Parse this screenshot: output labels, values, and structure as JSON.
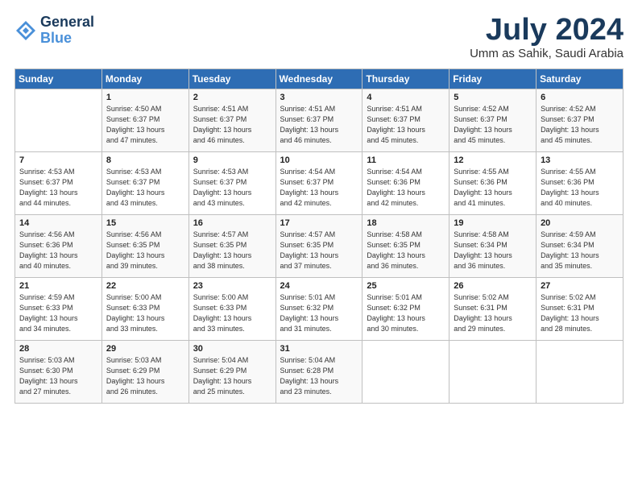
{
  "header": {
    "logo_line1": "General",
    "logo_line2": "Blue",
    "month_title": "July 2024",
    "location": "Umm as Sahik, Saudi Arabia"
  },
  "days_of_week": [
    "Sunday",
    "Monday",
    "Tuesday",
    "Wednesday",
    "Thursday",
    "Friday",
    "Saturday"
  ],
  "weeks": [
    [
      {
        "day": "",
        "sunrise": "",
        "sunset": "",
        "daylight": ""
      },
      {
        "day": "1",
        "sunrise": "Sunrise: 4:50 AM",
        "sunset": "Sunset: 6:37 PM",
        "daylight": "Daylight: 13 hours and 47 minutes."
      },
      {
        "day": "2",
        "sunrise": "Sunrise: 4:51 AM",
        "sunset": "Sunset: 6:37 PM",
        "daylight": "Daylight: 13 hours and 46 minutes."
      },
      {
        "day": "3",
        "sunrise": "Sunrise: 4:51 AM",
        "sunset": "Sunset: 6:37 PM",
        "daylight": "Daylight: 13 hours and 46 minutes."
      },
      {
        "day": "4",
        "sunrise": "Sunrise: 4:51 AM",
        "sunset": "Sunset: 6:37 PM",
        "daylight": "Daylight: 13 hours and 45 minutes."
      },
      {
        "day": "5",
        "sunrise": "Sunrise: 4:52 AM",
        "sunset": "Sunset: 6:37 PM",
        "daylight": "Daylight: 13 hours and 45 minutes."
      },
      {
        "day": "6",
        "sunrise": "Sunrise: 4:52 AM",
        "sunset": "Sunset: 6:37 PM",
        "daylight": "Daylight: 13 hours and 45 minutes."
      }
    ],
    [
      {
        "day": "7",
        "sunrise": "Sunrise: 4:53 AM",
        "sunset": "Sunset: 6:37 PM",
        "daylight": "Daylight: 13 hours and 44 minutes."
      },
      {
        "day": "8",
        "sunrise": "Sunrise: 4:53 AM",
        "sunset": "Sunset: 6:37 PM",
        "daylight": "Daylight: 13 hours and 43 minutes."
      },
      {
        "day": "9",
        "sunrise": "Sunrise: 4:53 AM",
        "sunset": "Sunset: 6:37 PM",
        "daylight": "Daylight: 13 hours and 43 minutes."
      },
      {
        "day": "10",
        "sunrise": "Sunrise: 4:54 AM",
        "sunset": "Sunset: 6:37 PM",
        "daylight": "Daylight: 13 hours and 42 minutes."
      },
      {
        "day": "11",
        "sunrise": "Sunrise: 4:54 AM",
        "sunset": "Sunset: 6:36 PM",
        "daylight": "Daylight: 13 hours and 42 minutes."
      },
      {
        "day": "12",
        "sunrise": "Sunrise: 4:55 AM",
        "sunset": "Sunset: 6:36 PM",
        "daylight": "Daylight: 13 hours and 41 minutes."
      },
      {
        "day": "13",
        "sunrise": "Sunrise: 4:55 AM",
        "sunset": "Sunset: 6:36 PM",
        "daylight": "Daylight: 13 hours and 40 minutes."
      }
    ],
    [
      {
        "day": "14",
        "sunrise": "Sunrise: 4:56 AM",
        "sunset": "Sunset: 6:36 PM",
        "daylight": "Daylight: 13 hours and 40 minutes."
      },
      {
        "day": "15",
        "sunrise": "Sunrise: 4:56 AM",
        "sunset": "Sunset: 6:35 PM",
        "daylight": "Daylight: 13 hours and 39 minutes."
      },
      {
        "day": "16",
        "sunrise": "Sunrise: 4:57 AM",
        "sunset": "Sunset: 6:35 PM",
        "daylight": "Daylight: 13 hours and 38 minutes."
      },
      {
        "day": "17",
        "sunrise": "Sunrise: 4:57 AM",
        "sunset": "Sunset: 6:35 PM",
        "daylight": "Daylight: 13 hours and 37 minutes."
      },
      {
        "day": "18",
        "sunrise": "Sunrise: 4:58 AM",
        "sunset": "Sunset: 6:35 PM",
        "daylight": "Daylight: 13 hours and 36 minutes."
      },
      {
        "day": "19",
        "sunrise": "Sunrise: 4:58 AM",
        "sunset": "Sunset: 6:34 PM",
        "daylight": "Daylight: 13 hours and 36 minutes."
      },
      {
        "day": "20",
        "sunrise": "Sunrise: 4:59 AM",
        "sunset": "Sunset: 6:34 PM",
        "daylight": "Daylight: 13 hours and 35 minutes."
      }
    ],
    [
      {
        "day": "21",
        "sunrise": "Sunrise: 4:59 AM",
        "sunset": "Sunset: 6:33 PM",
        "daylight": "Daylight: 13 hours and 34 minutes."
      },
      {
        "day": "22",
        "sunrise": "Sunrise: 5:00 AM",
        "sunset": "Sunset: 6:33 PM",
        "daylight": "Daylight: 13 hours and 33 minutes."
      },
      {
        "day": "23",
        "sunrise": "Sunrise: 5:00 AM",
        "sunset": "Sunset: 6:33 PM",
        "daylight": "Daylight: 13 hours and 33 minutes."
      },
      {
        "day": "24",
        "sunrise": "Sunrise: 5:01 AM",
        "sunset": "Sunset: 6:32 PM",
        "daylight": "Daylight: 13 hours and 31 minutes."
      },
      {
        "day": "25",
        "sunrise": "Sunrise: 5:01 AM",
        "sunset": "Sunset: 6:32 PM",
        "daylight": "Daylight: 13 hours and 30 minutes."
      },
      {
        "day": "26",
        "sunrise": "Sunrise: 5:02 AM",
        "sunset": "Sunset: 6:31 PM",
        "daylight": "Daylight: 13 hours and 29 minutes."
      },
      {
        "day": "27",
        "sunrise": "Sunrise: 5:02 AM",
        "sunset": "Sunset: 6:31 PM",
        "daylight": "Daylight: 13 hours and 28 minutes."
      }
    ],
    [
      {
        "day": "28",
        "sunrise": "Sunrise: 5:03 AM",
        "sunset": "Sunset: 6:30 PM",
        "daylight": "Daylight: 13 hours and 27 minutes."
      },
      {
        "day": "29",
        "sunrise": "Sunrise: 5:03 AM",
        "sunset": "Sunset: 6:29 PM",
        "daylight": "Daylight: 13 hours and 26 minutes."
      },
      {
        "day": "30",
        "sunrise": "Sunrise: 5:04 AM",
        "sunset": "Sunset: 6:29 PM",
        "daylight": "Daylight: 13 hours and 25 minutes."
      },
      {
        "day": "31",
        "sunrise": "Sunrise: 5:04 AM",
        "sunset": "Sunset: 6:28 PM",
        "daylight": "Daylight: 13 hours and 23 minutes."
      },
      {
        "day": "",
        "sunrise": "",
        "sunset": "",
        "daylight": ""
      },
      {
        "day": "",
        "sunrise": "",
        "sunset": "",
        "daylight": ""
      },
      {
        "day": "",
        "sunrise": "",
        "sunset": "",
        "daylight": ""
      }
    ]
  ]
}
